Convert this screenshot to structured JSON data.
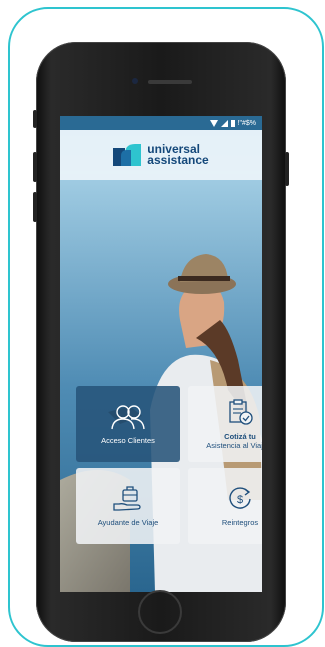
{
  "status_bar": {
    "text": "!\"#$%"
  },
  "brand": {
    "line1": "universal",
    "line2": "assistance"
  },
  "tiles": [
    {
      "icon": "users-icon",
      "label": "Acceso Clientes"
    },
    {
      "icon": "clipboard-check-icon",
      "title": "Cotizá tu",
      "label": "Asistencia al Viajero"
    },
    {
      "icon": "suitcase-hand-icon",
      "label": "Ayudante de Viaje"
    },
    {
      "icon": "dollar-refund-icon",
      "label": "Reintegros"
    }
  ],
  "colors": {
    "accent_frame": "#2ec4cf",
    "brand_blue": "#14487a"
  }
}
